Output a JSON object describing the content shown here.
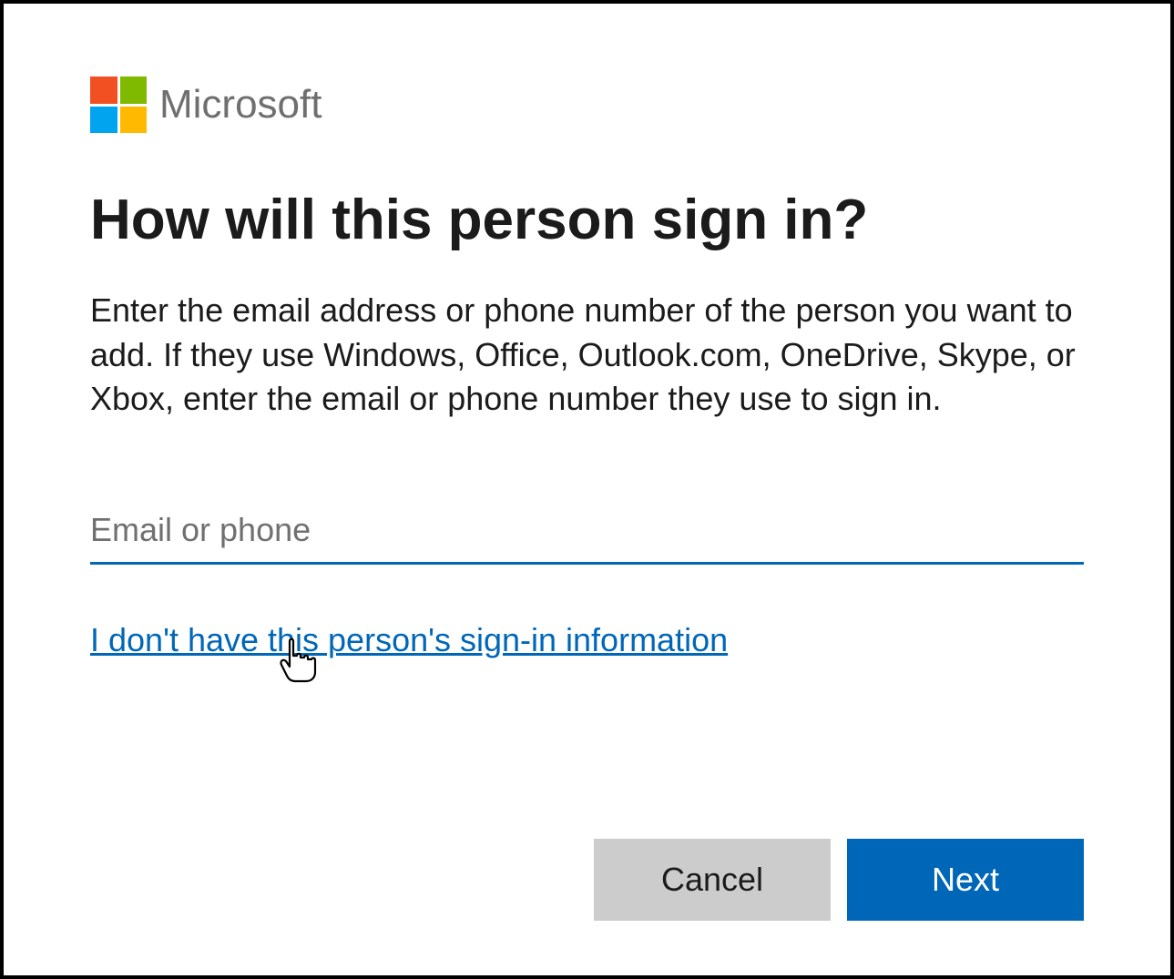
{
  "brand": {
    "name": "Microsoft",
    "logo_colors": {
      "top_left": "#F25022",
      "top_right": "#7FBA00",
      "bottom_left": "#00A4EF",
      "bottom_right": "#FFB900"
    }
  },
  "dialog": {
    "heading": "How will this person sign in?",
    "description": "Enter the email address or phone number of the person you want to add. If they use Windows, Office, Outlook.com, OneDrive, Skype, or Xbox, enter the email or phone number they use to sign in.",
    "input": {
      "placeholder": "Email or phone",
      "value": ""
    },
    "alt_link": "I don't have this person's sign-in information",
    "buttons": {
      "cancel": "Cancel",
      "next": "Next"
    }
  },
  "colors": {
    "accent": "#0067B8",
    "button_secondary": "#CCCCCC"
  }
}
